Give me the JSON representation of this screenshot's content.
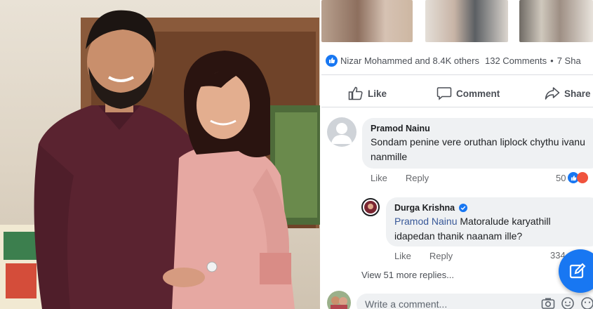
{
  "post": {
    "reactions": {
      "summary": "Nizar Mohammed and 8.4K others",
      "comments": "132 Comments",
      "separator": "•",
      "shares": "7 Sha"
    },
    "actions": {
      "like": "Like",
      "comment": "Comment",
      "share": "Share"
    }
  },
  "comments": [
    {
      "author": "Pramod Nainu",
      "text": "Sondam penine vere oruthan liplock chythu ivanu nanmille",
      "like_label": "Like",
      "reply_label": "Reply",
      "reaction_count": "50"
    }
  ],
  "reply": {
    "author": "Durga Krishna",
    "verified": true,
    "mention": "Pramod Nainu",
    "text": "Matoralude karyathill idapedan thanik naanam ille?",
    "like_label": "Like",
    "reply_label": "Reply",
    "reaction_count": "334"
  },
  "view_more": "View 51 more replies...",
  "composer": {
    "placeholder": "Write a comment..."
  },
  "icons": [
    "like-icon",
    "comment-icon",
    "share-icon",
    "camera-icon",
    "gif-icon",
    "sticker-icon",
    "compose-icon",
    "verified-icon"
  ],
  "colors": {
    "brand_blue": "#1877f2",
    "bubble_bg": "#eff1f3",
    "text_muted": "#65676b",
    "mention": "#385898"
  }
}
